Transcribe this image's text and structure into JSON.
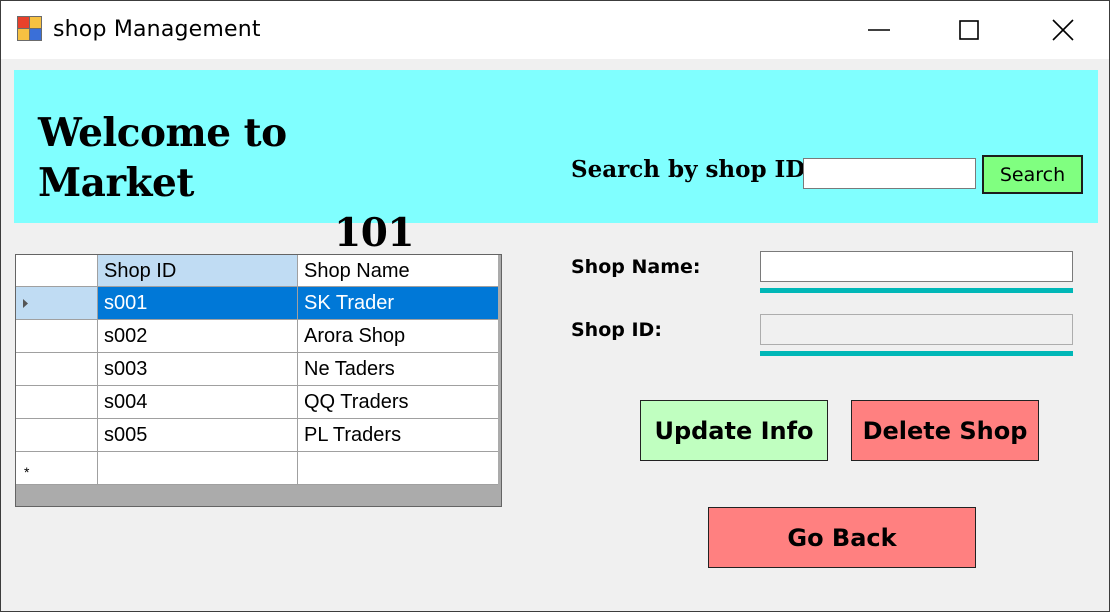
{
  "window": {
    "title": "shop Management",
    "controls": {
      "minimize": "minimize-icon",
      "maximize": "maximize-icon",
      "close": "close-icon"
    }
  },
  "header": {
    "welcome_line1": "Welcome to Market",
    "welcome_line2": "101",
    "background_color": "#80ffff",
    "search_label": "Search by shop ID",
    "search_value": "",
    "search_button": "Search",
    "search_button_color": "#80ff80"
  },
  "grid": {
    "columns": [
      "",
      "Shop ID",
      "Shop Name"
    ],
    "rows": [
      {
        "id": "s001",
        "name": "SK Trader",
        "selected": true
      },
      {
        "id": "s002",
        "name": "Arora Shop",
        "selected": false
      },
      {
        "id": "s003",
        "name": "Ne Taders",
        "selected": false
      },
      {
        "id": "s004",
        "name": "QQ Traders",
        "selected": false
      },
      {
        "id": "s005",
        "name": "PL Traders",
        "selected": false
      }
    ],
    "new_row_marker": "*",
    "selection_color": "#0078d7"
  },
  "form": {
    "shop_name_label": "Shop Name:",
    "shop_name_value": "",
    "shop_id_label": "Shop ID:",
    "shop_id_value": "",
    "underline_color": "#00b7b7"
  },
  "buttons": {
    "update": {
      "label": "Update Info",
      "color": "#c0ffc0"
    },
    "delete": {
      "label": "Delete Shop",
      "color": "#ff8080"
    },
    "back": {
      "label": "Go Back",
      "color": "#ff8080"
    }
  }
}
